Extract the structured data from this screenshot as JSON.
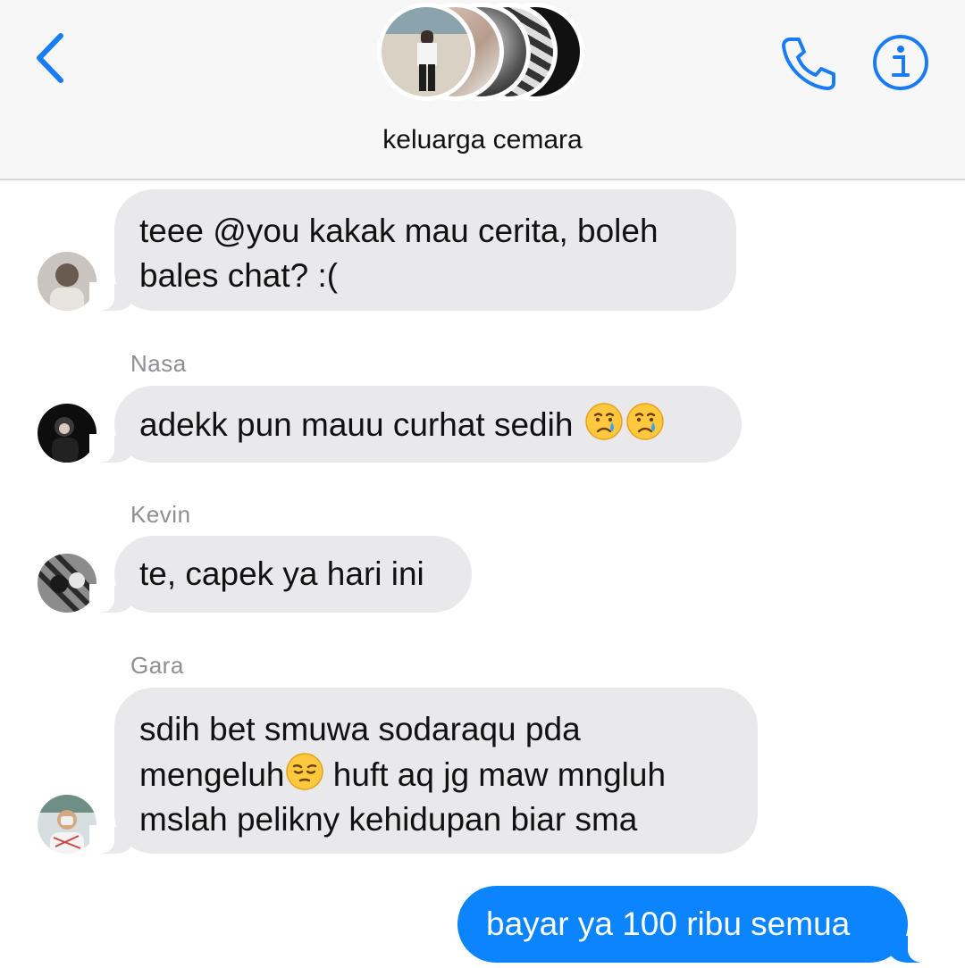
{
  "header": {
    "title": "keluarga cemara",
    "back_icon": "chevron-left-icon",
    "call_icon": "phone-icon",
    "info_icon": "info-icon",
    "accent": "#1a7cf5"
  },
  "messages": [
    {
      "sender": "",
      "lines": [
        "teee @you kakak mau cerita, boleh",
        "bales chat? :("
      ]
    },
    {
      "sender": "Nasa",
      "lines": [
        "adekk pun mauu curhat sedih"
      ],
      "emoji": [
        "crying-face-emoji",
        "crying-face-emoji"
      ]
    },
    {
      "sender": "Kevin",
      "lines": [
        "te, capek ya hari ini"
      ]
    },
    {
      "sender": "Gara",
      "lines": [
        "sdih bet smuwa sodaraqu pda",
        "mengeluh",
        " huft aq jg maw mngluh",
        "mslah pelikny kehidupan biar sma"
      ],
      "emoji": [
        "pensive-face-emoji"
      ]
    },
    {
      "sender": "me",
      "lines": [
        "bayar ya 100 ribu semua"
      ]
    }
  ],
  "colors": {
    "incoming_bubble": "#e9e9eb",
    "outgoing_bubble": "#0b84fe",
    "sender_name": "#8e8e93"
  }
}
